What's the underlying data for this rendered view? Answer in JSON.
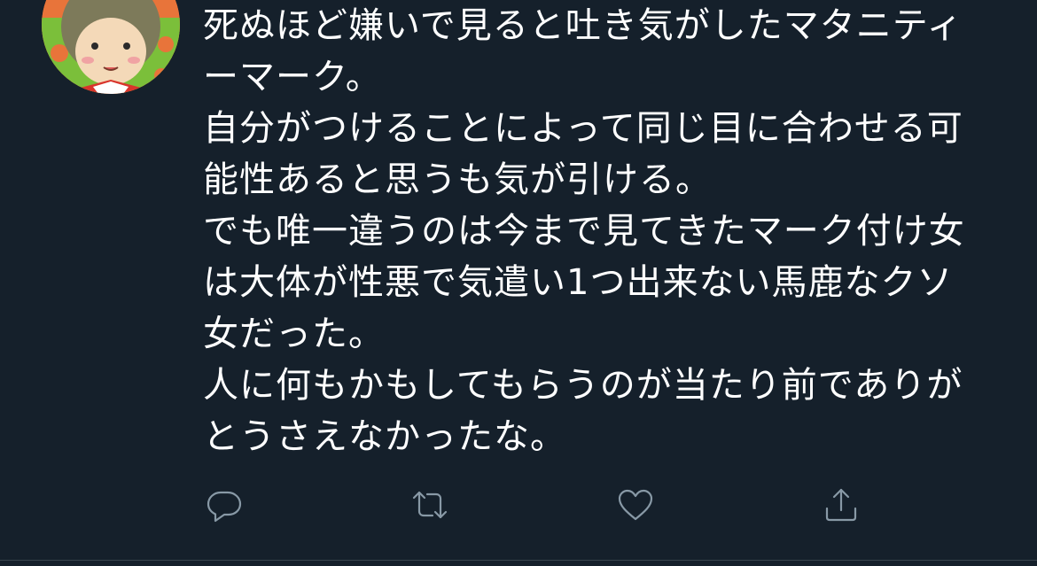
{
  "tweet": {
    "lines": [
      "死ぬほど嫌いで見ると吐き気がしたマタニティ",
      "ーマーク。",
      "自分がつけることによって同じ目に合わせる可",
      "能性あると思うも気が引ける。",
      "でも唯一違うのは今まで見てきたマーク付け女",
      "は大体が性悪で気遣い1つ出来ない馬鹿なクソ",
      "女だった。",
      "人に何もかもしてもらうのが当たり前でありが",
      "とうさえなかったな。"
    ]
  },
  "actions": [
    {
      "name": "reply",
      "icon": "reply-icon"
    },
    {
      "name": "retweet",
      "icon": "retweet-icon"
    },
    {
      "name": "like",
      "icon": "heart-icon"
    },
    {
      "name": "share",
      "icon": "share-icon"
    }
  ],
  "colors": {
    "background": "#15202b",
    "text": "#ffffff",
    "icon": "#8899a6",
    "divider": "#38444d"
  }
}
